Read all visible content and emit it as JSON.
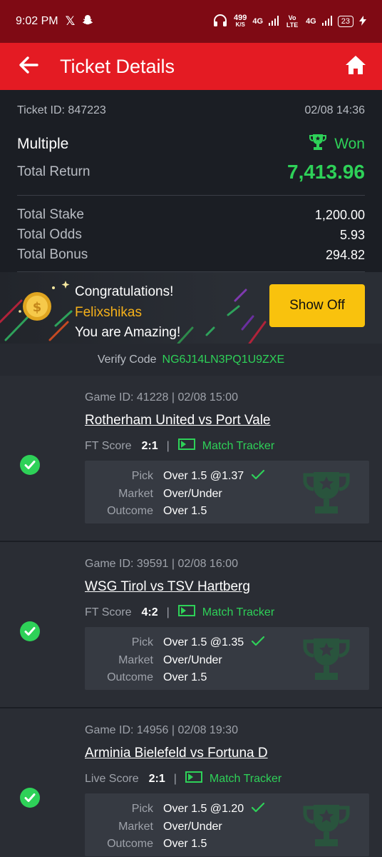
{
  "status_bar": {
    "time": "9:02 PM",
    "speed": "499",
    "speed_unit": "K/S",
    "net1": "4G",
    "net2": "Vo LTE",
    "net3": "4G",
    "battery": "23"
  },
  "header": {
    "title": "Ticket Details"
  },
  "ticket": {
    "id_label": "Ticket ID:",
    "id": "847223",
    "datetime": "02/08 14:36",
    "type": "Multiple",
    "result": "Won",
    "total_return_label": "Total Return",
    "total_return": "7,413.96",
    "total_stake_label": "Total Stake",
    "total_stake": "1,200.00",
    "total_odds_label": "Total Odds",
    "total_odds": "5.93",
    "total_bonus_label": "Total Bonus",
    "total_bonus": "294.82"
  },
  "congrats": {
    "line1": "Congratulations!",
    "username": "Felixshikas",
    "line3": "You are Amazing!",
    "button": "Show Off"
  },
  "verify": {
    "label": "Verify Code",
    "code": "NG6J14LN3PQ1U9ZXE"
  },
  "bets": [
    {
      "game_id": "Game ID: 41228 | 02/08 15:00",
      "match": "Rotherham United vs Port Vale",
      "score_label": "FT Score",
      "score": "2:1",
      "tracker": "Match Tracker",
      "pick_label": "Pick",
      "pick": "Over 1.5 @1.37",
      "market_label": "Market",
      "market": "Over/Under",
      "outcome_label": "Outcome",
      "outcome": "Over 1.5"
    },
    {
      "game_id": "Game ID: 39591 | 02/08 16:00",
      "match": "WSG Tirol vs TSV Hartberg",
      "score_label": "FT Score",
      "score": "4:2",
      "tracker": "Match Tracker",
      "pick_label": "Pick",
      "pick": "Over 1.5 @1.35",
      "market_label": "Market",
      "market": "Over/Under",
      "outcome_label": "Outcome",
      "outcome": "Over 1.5"
    },
    {
      "game_id": "Game ID: 14956 | 02/08 19:30",
      "match": "Arminia Bielefeld vs Fortuna D",
      "score_label": "Live Score",
      "score": "2:1",
      "tracker": "Match Tracker",
      "pick_label": "Pick",
      "pick": "Over 1.5 @1.20",
      "market_label": "Market",
      "market": "Over/Under",
      "outcome_label": "Outcome",
      "outcome": "Over 1.5"
    }
  ],
  "colors": {
    "brand_red": "#e41b23",
    "win_green": "#2ed158",
    "button_yellow": "#f9c20d"
  }
}
